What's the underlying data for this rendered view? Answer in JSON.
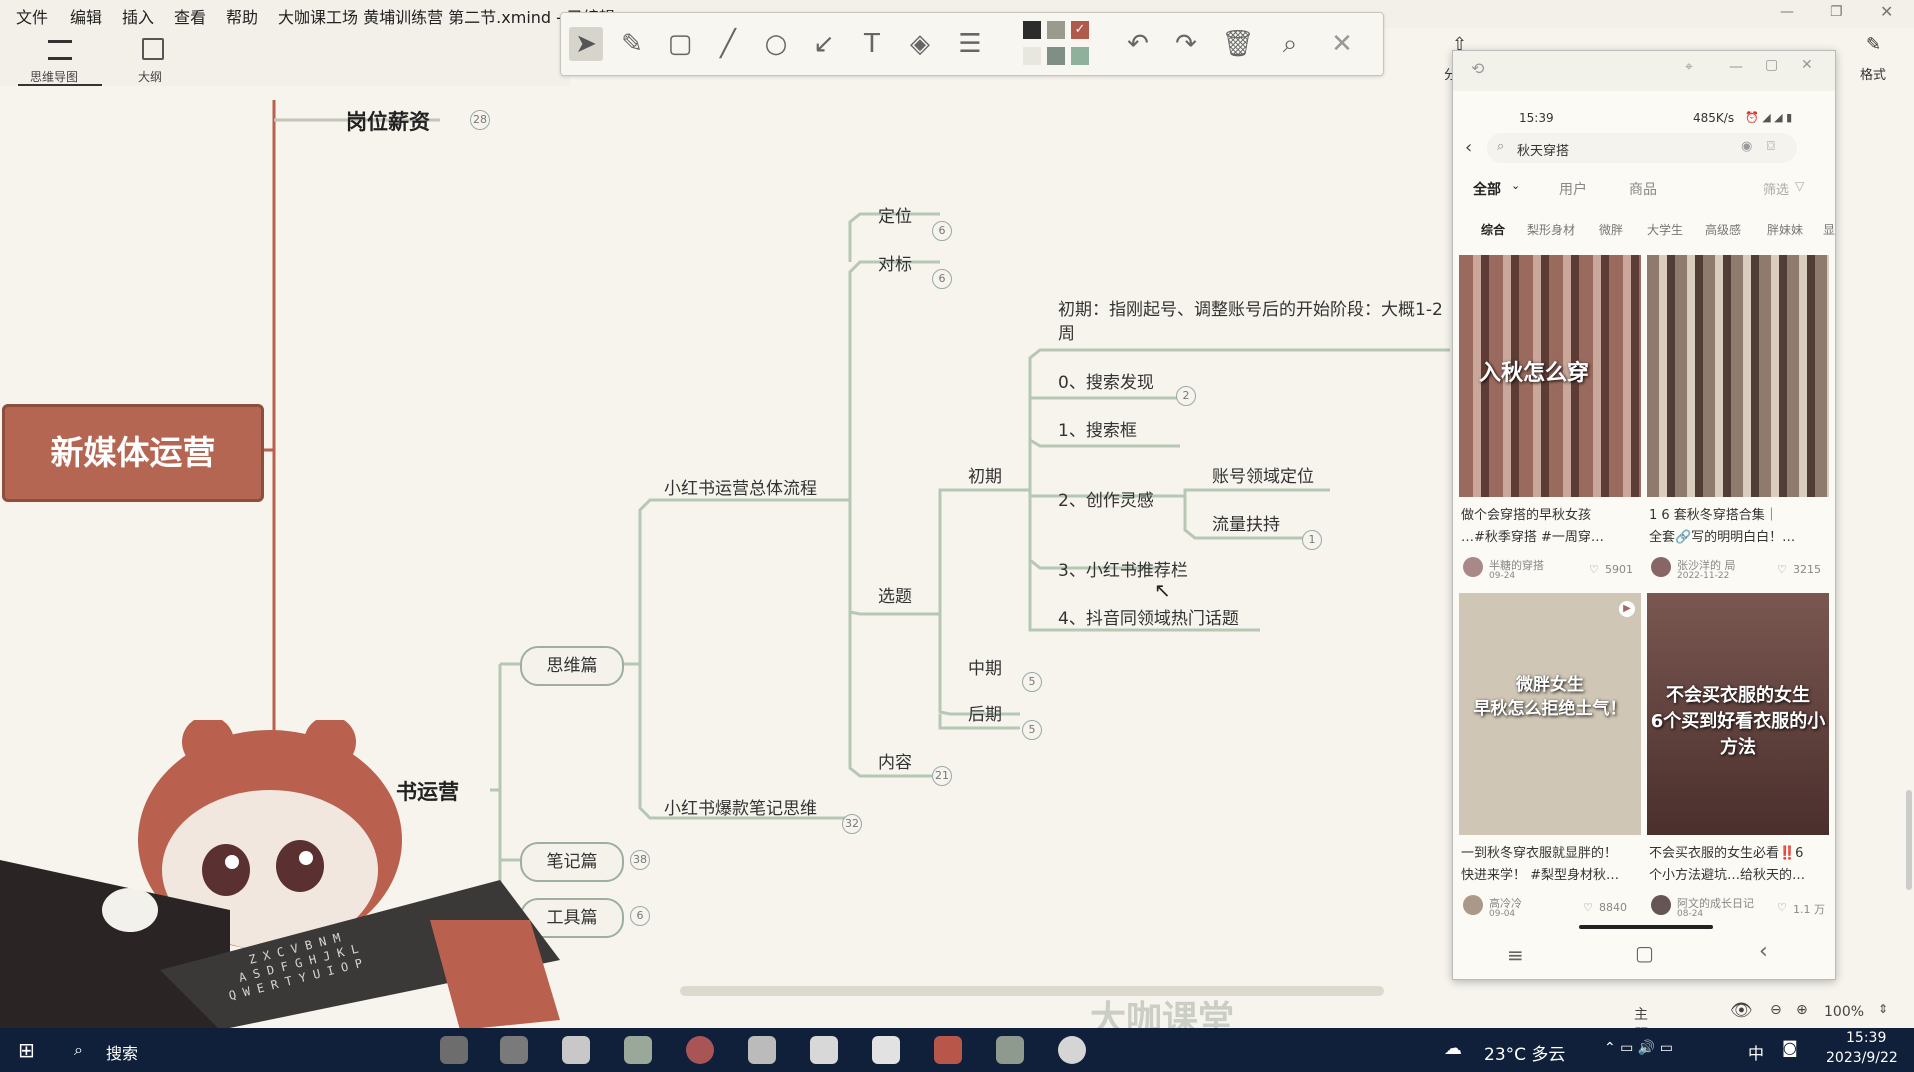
{
  "menu": [
    "文件",
    "编辑",
    "插入",
    "查看",
    "帮助"
  ],
  "window_title": "大咖课工场 黄埔训练营 第二节.xmind - 已编辑",
  "left_tabs": [
    "思维导图",
    "大纲"
  ],
  "right_tabs": [
    "分",
    "格式"
  ],
  "annotation_toolbar": {
    "tools": [
      "select-arrow-icon",
      "pen-icon",
      "rectangle-icon",
      "line-icon",
      "circle-icon",
      "arrow-icon",
      "text-icon",
      "eraser-icon",
      "line-width-icon"
    ],
    "colors": [
      "#2c2c2c",
      "#9a9a8e",
      "#b05a4c",
      "#e7e7e0",
      "#7f8f85",
      "#8fb09a"
    ],
    "actions": [
      "undo-icon",
      "redo-icon",
      "delete-icon",
      "zoom-icon",
      "close-icon"
    ]
  },
  "mindmap": {
    "root": "新媒体运营",
    "top_branch": {
      "label": "岗位薪资",
      "count": "28"
    },
    "main_branch": "书运营",
    "pills": [
      {
        "label": "思维篇"
      },
      {
        "label": "笔记篇",
        "count": "38"
      },
      {
        "label": "工具篇",
        "count": "6"
      }
    ],
    "sub": {
      "process": "小红书运营总体流程",
      "hot_notes": "小红书爆款笔记思维",
      "hot_notes_count": "32"
    },
    "process_children": [
      {
        "label": "定位",
        "count": "6"
      },
      {
        "label": "对标",
        "count": "6"
      },
      {
        "label": "选题"
      },
      {
        "label": "内容",
        "count": "21"
      }
    ],
    "topic_phases": [
      {
        "label": "初期"
      },
      {
        "label": "中期",
        "count": "5"
      },
      {
        "label": "后期",
        "count": "5"
      }
    ],
    "early_note": "初期：指刚起号、调整账号后的开始阶段：大概1-2周",
    "early_steps": [
      {
        "label": "0、搜索发现",
        "count": "2"
      },
      {
        "label": "1、搜索框"
      },
      {
        "label": "2、创作灵感"
      },
      {
        "label": "3、小红书推荐栏"
      },
      {
        "label": "4、抖音同领域热门话题"
      }
    ],
    "inspiration_children": [
      {
        "label": "账号领域定位"
      },
      {
        "label": "流量扶持",
        "count": "1"
      }
    ]
  },
  "phone": {
    "status_time": "15:39",
    "status_speed": "485K/s",
    "search_text": "秋天穿搭",
    "tabs": [
      "全部",
      "用户",
      "商品",
      "筛选"
    ],
    "filters": [
      "综合",
      "梨形身材",
      "微胖",
      "大学生",
      "高级感",
      "胖妹妹",
      "显"
    ],
    "cards": [
      {
        "overlay": "入秋怎么穿",
        "caption1": "做个会穿搭的早秋女孩",
        "caption2": "…#秋季穿搭 #一周穿…",
        "author": "半糖的穿搭",
        "date": "09-24",
        "likes": "5901",
        "tint": "#9b6a5f"
      },
      {
        "overlay": "",
        "caption1": "1 6 套秋冬穿搭合集｜",
        "caption2": "全套🔗写的明明白白！…",
        "author": "张沙洋的 局",
        "date": "2022-11-22",
        "likes": "3215",
        "tint": "#8f7b6e"
      },
      {
        "overlay": "微胖女生\n早秋怎么拒绝土气！",
        "caption1": "一到秋冬穿衣服就显胖的！",
        "caption2": "快进来学！ #梨型身材秋…",
        "author": "高冷冷",
        "date": "09-04",
        "likes": "8840",
        "tint": "#cfc6b5"
      },
      {
        "overlay": "不会买衣服的女生\n6个买到好看衣服的小方法",
        "caption1": "不会买衣服的女生必看‼️6",
        "caption2": "个小方法避坑…给秋天的…",
        "author": "阿文的成长日记",
        "date": "08-24",
        "likes": "1.1 万",
        "tint": "#6d4c46"
      }
    ]
  },
  "statusbar": {
    "theme": "主题",
    "zoom": "100%"
  },
  "watermark": "大咖课堂",
  "taskbar": {
    "search": "搜索",
    "weather": "23°C 多云",
    "ime": "中",
    "time": "15:39",
    "date": "2023/9/22"
  }
}
